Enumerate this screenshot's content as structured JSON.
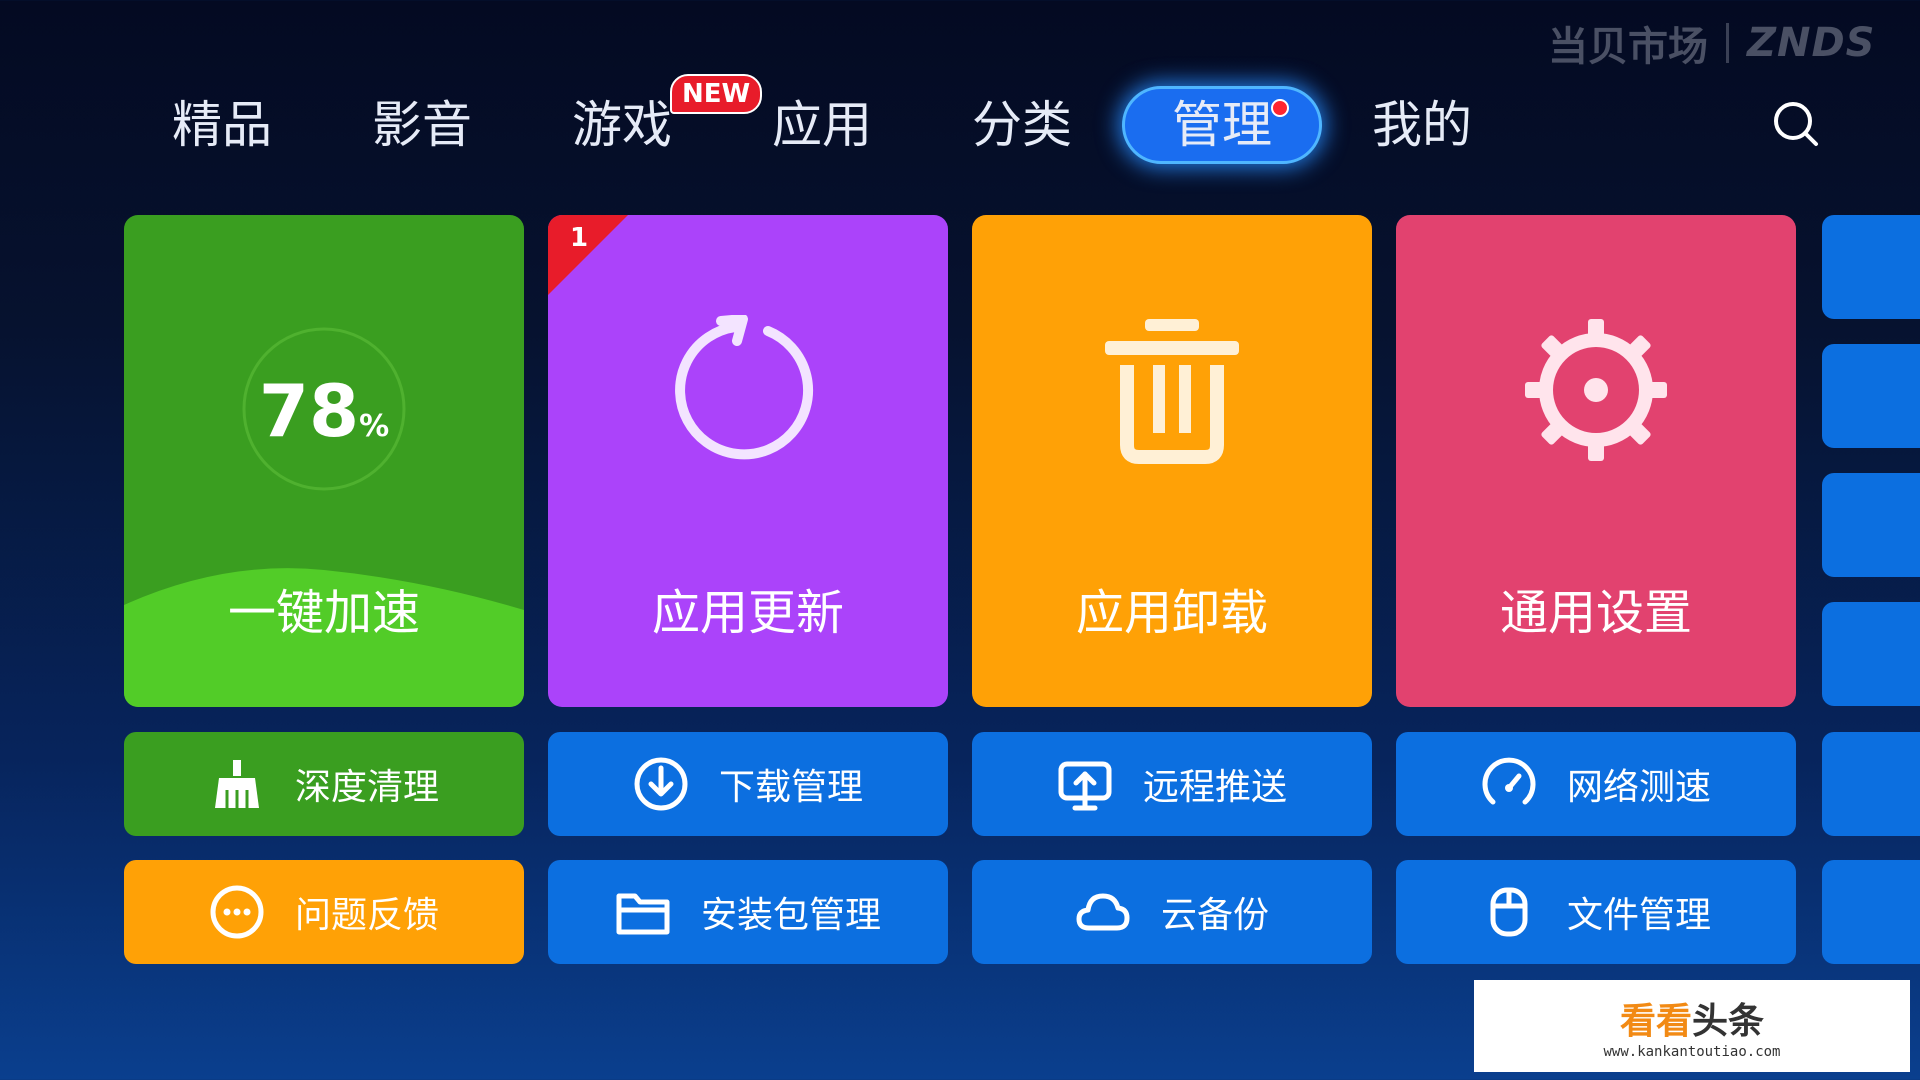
{
  "brand": {
    "left": "当贝市场",
    "right": "ZNDS"
  },
  "nav": {
    "tabs": [
      "精品",
      "影音",
      "游戏",
      "应用",
      "分类",
      "管理",
      "我的"
    ],
    "new_badge": "NEW"
  },
  "tiles": {
    "speedup": {
      "percent": "78",
      "unit": "%",
      "label": "一键加速"
    },
    "update": {
      "badge": "1",
      "label": "应用更新"
    },
    "uninstall": {
      "label": "应用卸载"
    },
    "settings": {
      "label": "通用设置"
    }
  },
  "buttons": {
    "deep_clean": "深度清理",
    "download": "下载管理",
    "remote_push": "远程推送",
    "speed_test": "网络测速",
    "feedback": "问题反馈",
    "installer": "安装包管理",
    "cloud_backup": "云备份",
    "file_manager": "文件管理"
  },
  "watermark": {
    "title_a": "看看",
    "title_b": "头条",
    "url": "www.kankantoutiao.com"
  },
  "colors": {
    "green": "#3a9e20",
    "purple": "#ab43fa",
    "orange": "#ffa106",
    "pink": "#e2426f",
    "blue": "#0c6fe0",
    "accent": "#1a6df0"
  },
  "icons": [
    "search-icon",
    "refresh-icon",
    "trash-icon",
    "gear-icon",
    "broom-icon",
    "download-icon",
    "screen-cast-icon",
    "speedometer-icon",
    "more-dots-icon",
    "folder-icon",
    "cloud-icon",
    "mouse-icon"
  ]
}
